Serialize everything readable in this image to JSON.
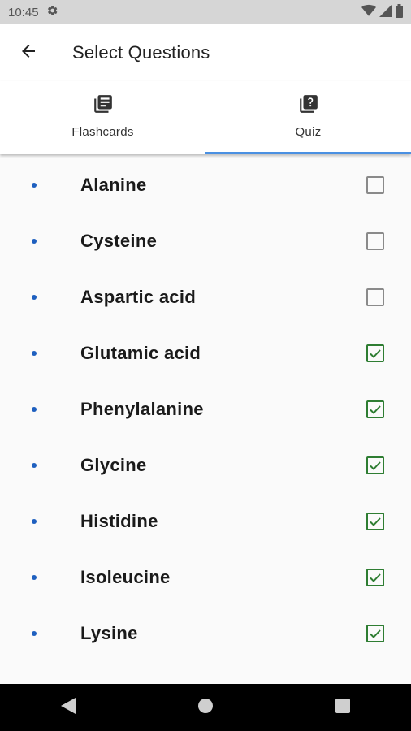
{
  "status_bar": {
    "time": "10:45"
  },
  "app_bar": {
    "title": "Select Questions"
  },
  "tabs": [
    {
      "label": "Flashcards",
      "selected": false
    },
    {
      "label": "Quiz",
      "selected": true
    }
  ],
  "items": [
    {
      "label": "Alanine",
      "checked": false
    },
    {
      "label": "Cysteine",
      "checked": false
    },
    {
      "label": "Aspartic acid",
      "checked": false
    },
    {
      "label": "Glutamic acid",
      "checked": true
    },
    {
      "label": "Phenylalanine",
      "checked": true
    },
    {
      "label": "Glycine",
      "checked": true
    },
    {
      "label": "Histidine",
      "checked": true
    },
    {
      "label": "Isoleucine",
      "checked": true
    },
    {
      "label": "Lysine",
      "checked": true
    }
  ],
  "colors": {
    "accent": "#4a90e2",
    "bullet": "#1e5fbf",
    "check_on": "#2e7d32",
    "check_off": "#8a8a8a"
  },
  "icons": {
    "settings": "gear-icon",
    "flashcards": "library-books-icon",
    "quiz": "quiz-question-icon",
    "back": "arrow-back-icon"
  }
}
